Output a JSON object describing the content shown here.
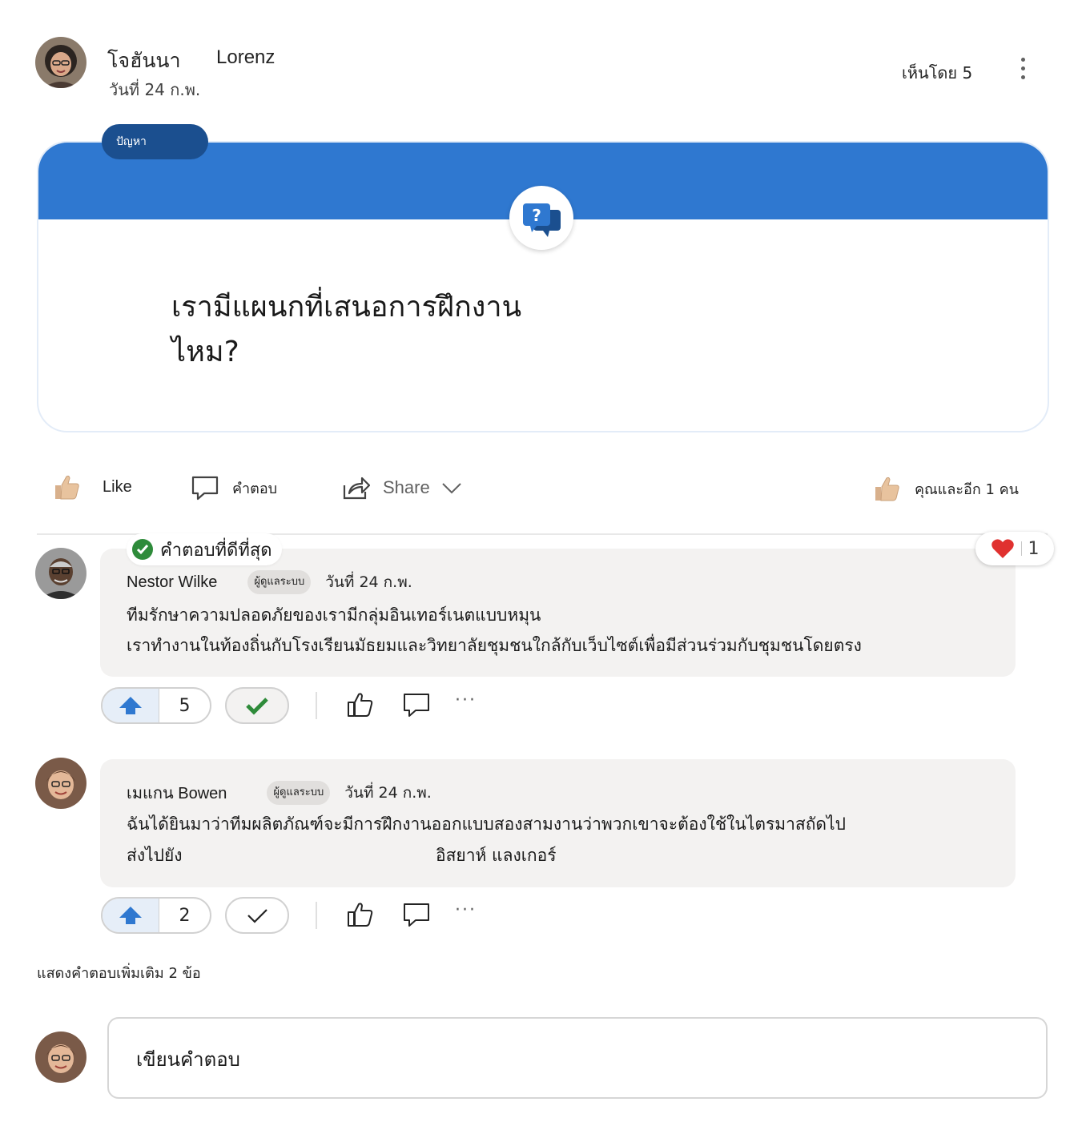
{
  "post": {
    "author_first": "โจฮันนา",
    "author_last": "Lorenz",
    "date": "วันที่ 24 ก.พ.",
    "seen_by": "เห็นโดย 5",
    "tag": "ปัญหา",
    "question": "เรามีแผนกที่เสนอการฝึกงานไหม?"
  },
  "actions": {
    "like": "Like",
    "reply": "คำตอบ",
    "share": "Share",
    "liked_summary": "คุณและอีก 1 คน"
  },
  "colors": {
    "band": "#2f78d0",
    "tag_bg": "#1b4f8f",
    "accept_green": "#2e8b3a",
    "upvote_blue": "#2f78d0",
    "heart_red": "#e0312f"
  },
  "best_answer_label": "คำตอบที่ดีที่สุด",
  "comments": [
    {
      "author": "Nestor Wilke",
      "badge": "ผู้ดูแลระบบ",
      "date": "วันที่ 24 ก.พ.",
      "line1": "ทีมรักษาความปลอดภัยของเรามีกลุ่มอินเทอร์เนตแบบหมุน",
      "line2": "เราทำงานในท้องถิ่นกับโรงเรียนมัธยมและวิทยาลัยชุมชนใกล้กับเว็บไซต์เพื่อมีส่วนร่วมกับชุมชนโดยตรง",
      "votes": "5",
      "reaction_count": "1",
      "accepted": true
    },
    {
      "author": "เมแกน Bowen",
      "badge": "ผู้ดูแลระบบ",
      "date": "วันที่ 24 ก.พ.",
      "line1": "ฉันได้ยินมาว่าทีมผลิตภัณฑ์จะมีการฝึกงานออกแบบสองสามงานว่าพวกเขาจะต้องใช้ในไตรมาสถัดไป",
      "line2a": "ส่งไปยัง",
      "line2b": "อิสยาห์ แลงเกอร์",
      "votes": "2",
      "accepted": false
    }
  ],
  "more_replies": "แสดงคำตอบเพิ่มเติม 2 ข้อ",
  "reply_placeholder": "เขียนคำตอบ",
  "icons": [
    "more-vertical-icon",
    "question-chat-icon",
    "thumbs-up-icon",
    "comment-icon",
    "share-icon",
    "chevron-down-icon",
    "check-circle-icon",
    "heart-icon",
    "upvote-arrow-icon",
    "checkmark-icon"
  ]
}
